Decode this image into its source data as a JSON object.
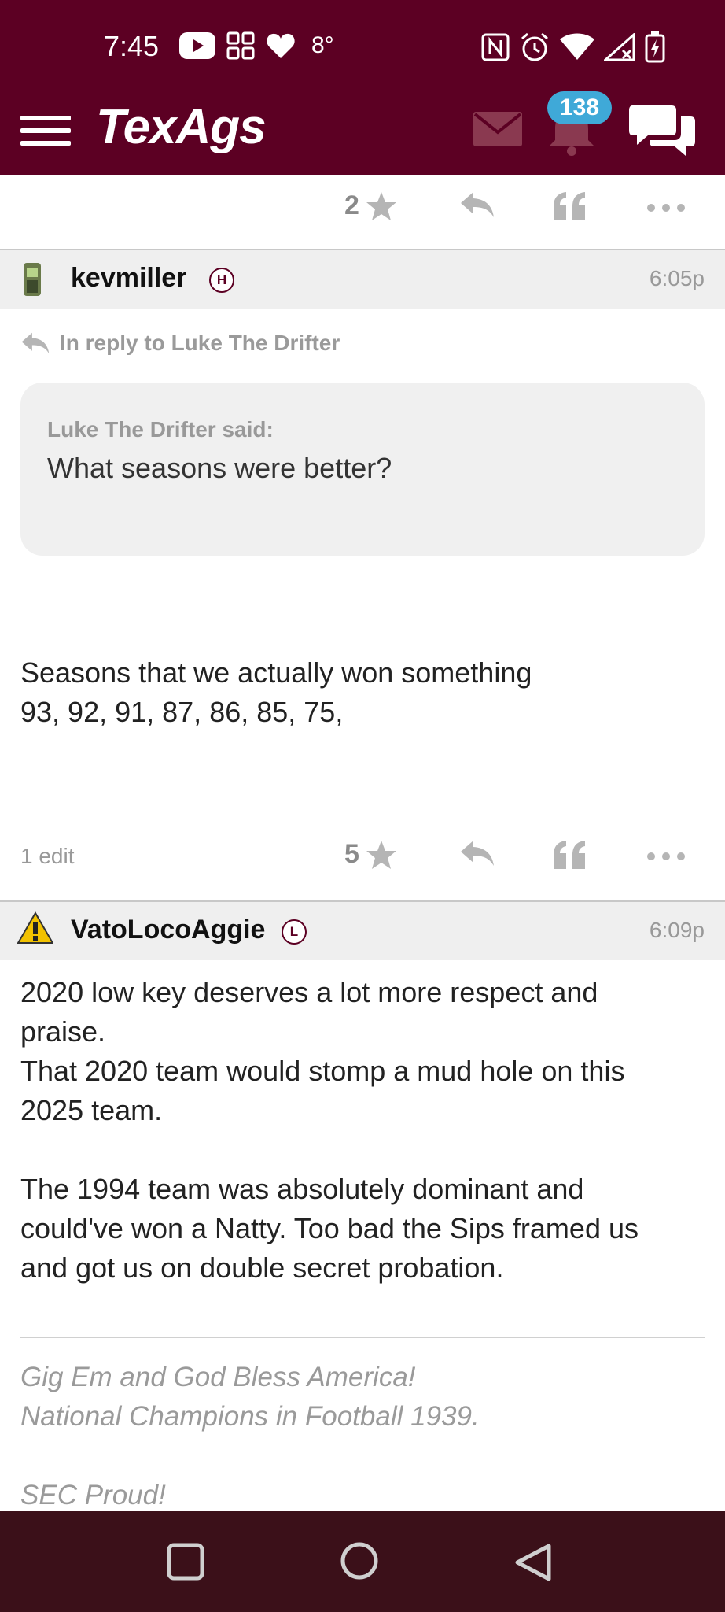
{
  "status_bar": {
    "time": "7:45",
    "temperature": "8°",
    "icons_left": [
      "youtube-icon",
      "grid-app-icon",
      "heart-icon"
    ],
    "icons_right": [
      "nfc-icon",
      "alarm-icon",
      "wifi-icon",
      "no-signal-icon",
      "battery-charging-icon"
    ]
  },
  "header": {
    "logo": "TexAgs",
    "notification_count": "138",
    "colors": {
      "maroon": "#5c0023",
      "badge": "#3fa9d8"
    }
  },
  "top_action_row": {
    "star_count": "2"
  },
  "posts": [
    {
      "username": "kevmiller",
      "rank": "H",
      "time": "6:05p",
      "reply_to": "In reply to Luke The Drifter",
      "quote_author": "Luke The Drifter said:",
      "quote_text": "What seasons were better?",
      "body_lines": [
        "Seasons that we actually won something",
        "93, 92, 91, 87, 86, 85, 75,"
      ],
      "edits": "1 edit",
      "star_count": "5"
    },
    {
      "username": "VatoLocoAggie",
      "rank": "L",
      "time": "6:09p",
      "body_lines": [
        "2020 low key deserves a lot more respect and",
        "praise.",
        "That 2020 team would stomp a mud hole on this",
        "2025 team.",
        "",
        "The 1994 team was absolutely dominant and",
        "could've won a Natty. Too bad the Sips framed us",
        "and got us on double secret probation."
      ],
      "signature_lines": [
        "Gig Em and God Bless America!",
        "National Champions in Football 1939.",
        "SEC Proud!"
      ]
    }
  ]
}
